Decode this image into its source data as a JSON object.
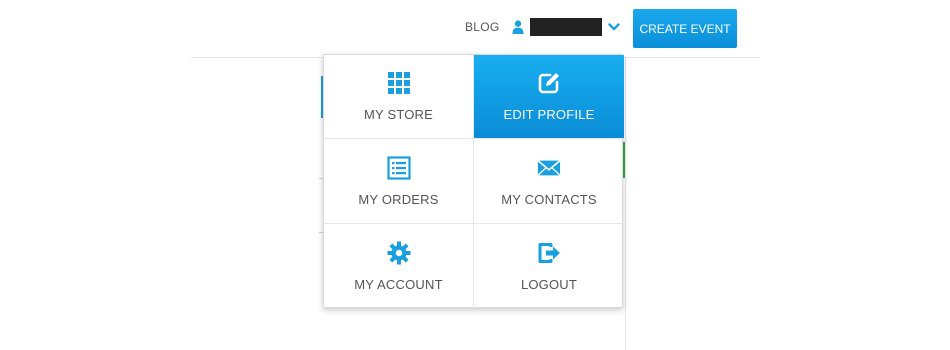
{
  "nav": {
    "blog_label": "BLOG",
    "create_event_label": "CREATE EVENT"
  },
  "colors": {
    "accent": "#1AA9EE",
    "icon": "#1AA0E0",
    "active_tile": "#0A8FD8",
    "text": "#555555"
  },
  "dropdown": {
    "items": [
      {
        "label": "MY STORE",
        "icon": "grid-icon",
        "active": false
      },
      {
        "label": "EDIT PROFILE",
        "icon": "edit-icon",
        "active": true
      },
      {
        "label": "MY ORDERS",
        "icon": "list-icon",
        "active": false
      },
      {
        "label": "MY CONTACTS",
        "icon": "envelope-icon",
        "active": false
      },
      {
        "label": "MY ACCOUNT",
        "icon": "gear-icon",
        "active": false
      },
      {
        "label": "LOGOUT",
        "icon": "logout-icon",
        "active": false
      }
    ]
  }
}
